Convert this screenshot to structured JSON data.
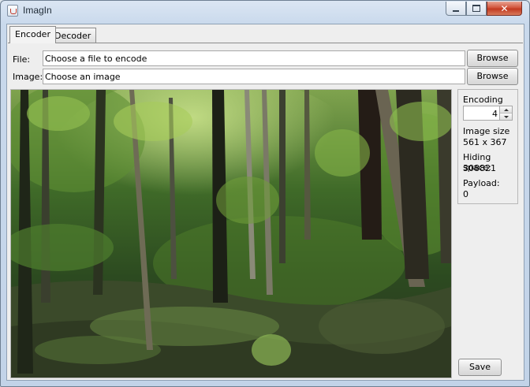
{
  "window": {
    "title": "ImagIn",
    "icon": "java-cup-icon"
  },
  "tabs": [
    {
      "label": "Encoder",
      "active": true
    },
    {
      "label": "Decoder",
      "active": false
    }
  ],
  "encoder": {
    "file_label": "File:",
    "file_value": "Choose a file to encode",
    "image_label": "Image:",
    "image_value": "Choose an image",
    "browse_label": "Browse",
    "encoding_bits_label": "Encoding bits",
    "encoding_bits_value": "4",
    "image_size_label": "Image size",
    "image_size_value": "561 x 367",
    "hiding_space_label": "Hiding space:",
    "hiding_space_value": "308821",
    "payload_label": "Payload:",
    "payload_value": "0",
    "save_label": "Save"
  },
  "preview": {
    "description_icon": "forest-photo"
  },
  "colors": {
    "close_button": "#c23a21",
    "panel_bg": "#eeeeee",
    "titlebar": "#c9d9ec"
  }
}
